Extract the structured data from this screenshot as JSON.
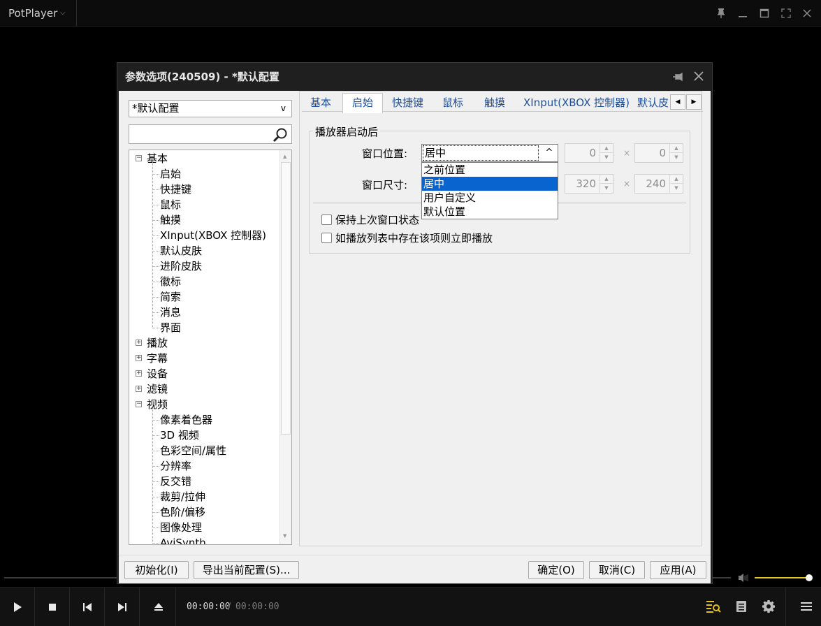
{
  "app": {
    "title": "PotPlayer",
    "menu_chevron": "⌵",
    "window_controls": [
      "pin-icon",
      "minimize-icon",
      "maximize-icon",
      "fullscreen-icon",
      "close-icon"
    ]
  },
  "dialog": {
    "title": "参数选项(240509) - *默认配置",
    "profile": {
      "value": "*默认配置",
      "arrow": "v"
    },
    "search": {
      "value": "",
      "placeholder": ""
    },
    "tree": [
      {
        "label": "基本",
        "level": 0,
        "toggle": "⊟"
      },
      {
        "label": "启始",
        "level": 1
      },
      {
        "label": "快捷键",
        "level": 1
      },
      {
        "label": "鼠标",
        "level": 1
      },
      {
        "label": "触摸",
        "level": 1
      },
      {
        "label": "XInput(XBOX 控制器)",
        "level": 1
      },
      {
        "label": "默认皮肤",
        "level": 1
      },
      {
        "label": "进阶皮肤",
        "level": 1
      },
      {
        "label": "徽标",
        "level": 1
      },
      {
        "label": "简索",
        "level": 1
      },
      {
        "label": "消息",
        "level": 1
      },
      {
        "label": "界面",
        "level": 1
      },
      {
        "label": "播放",
        "level": 0,
        "toggle": "⊞"
      },
      {
        "label": "字幕",
        "level": 0,
        "toggle": "⊞"
      },
      {
        "label": "设备",
        "level": 0,
        "toggle": "⊞"
      },
      {
        "label": "滤镜",
        "level": 0,
        "toggle": "⊞"
      },
      {
        "label": "视频",
        "level": 0,
        "toggle": "⊟"
      },
      {
        "label": "像素着色器",
        "level": 1
      },
      {
        "label": "3D 视频",
        "level": 1
      },
      {
        "label": "色彩空间/属性",
        "level": 1
      },
      {
        "label": "分辨率",
        "level": 1
      },
      {
        "label": "反交错",
        "level": 1
      },
      {
        "label": "裁剪/拉伸",
        "level": 1
      },
      {
        "label": "色阶/偏移",
        "level": 1
      },
      {
        "label": "图像处理",
        "level": 1
      },
      {
        "label": "AviSynth",
        "level": 1
      }
    ],
    "tabs": [
      "基本",
      "启始",
      "快捷键",
      "鼠标",
      "触摸",
      "XInput(XBOX 控制器)",
      "默认皮"
    ],
    "active_tab": "启始",
    "tab_arrows": [
      "◀",
      "▶"
    ],
    "section_title": "播放器启动后",
    "window_position": {
      "label": "窗口位置:",
      "value": "居中",
      "button": "^",
      "options": [
        "之前位置",
        "居中",
        "用户自定义",
        "默认位置"
      ],
      "selected": "居中",
      "x": "0",
      "y": "0"
    },
    "window_size": {
      "label": "窗口尺寸:",
      "width": "320",
      "height": "240"
    },
    "times_symbol": "×",
    "spin_up": "▲",
    "spin_down": "▼",
    "checkboxes": [
      {
        "label": "保持上次窗口状态",
        "checked": false
      },
      {
        "label": "如播放列表中存在该项则立即播放",
        "checked": false
      }
    ],
    "buttons": {
      "reset": "初始化(I)",
      "export": "导出当前配置(S)...",
      "ok": "确定(O)",
      "cancel": "取消(C)",
      "apply": "应用(A)"
    }
  },
  "player": {
    "time_current": "00:00:00",
    "time_separator": "/",
    "time_total": "00:00:00",
    "volume": 1.0,
    "accent_color": "#e6c21c"
  }
}
